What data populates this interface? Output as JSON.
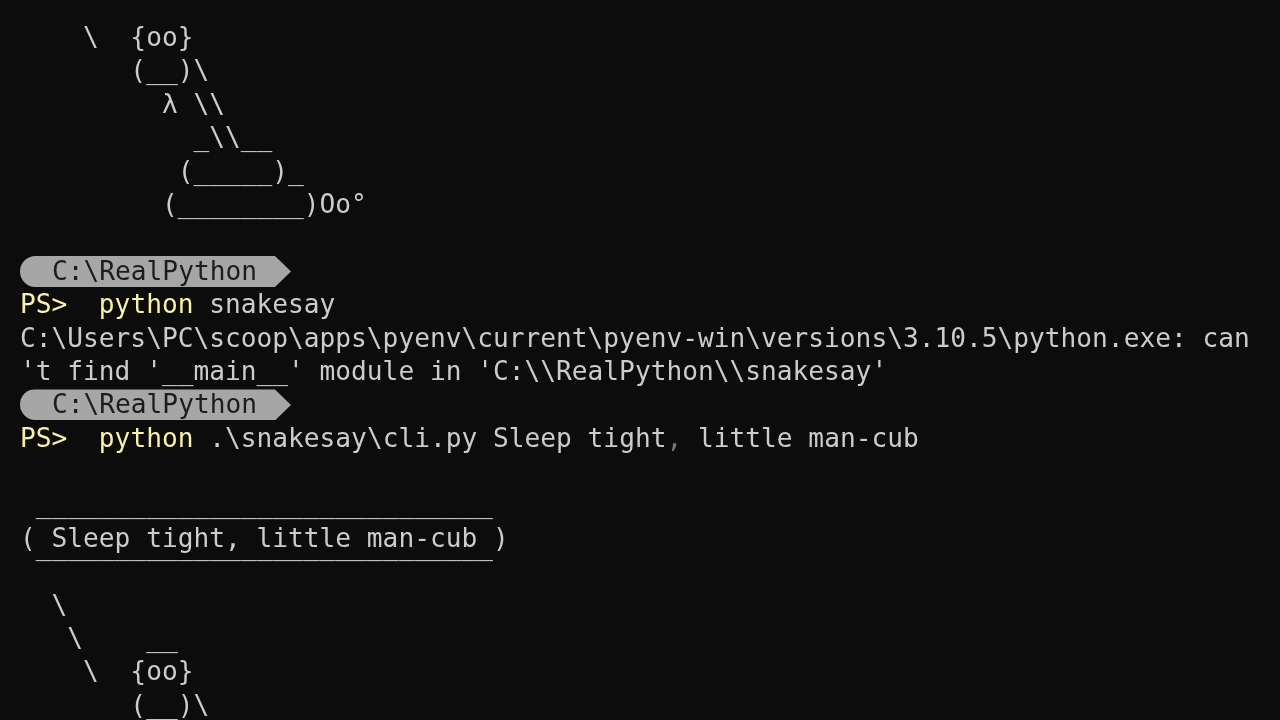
{
  "terminal": {
    "lines": [
      {
        "kind": "art",
        "text": "    \\  {oo}"
      },
      {
        "kind": "art",
        "text": "       (__)\\"
      },
      {
        "kind": "art",
        "text": "         λ \\\\"
      },
      {
        "kind": "art",
        "text": "           _\\\\__"
      },
      {
        "kind": "art",
        "text": "          (_____)_"
      },
      {
        "kind": "art",
        "text": "         (________)Oo°"
      },
      {
        "kind": "blank"
      },
      {
        "kind": "path",
        "text": "C:\\RealPython"
      },
      {
        "kind": "prompt",
        "prompt": "PS>",
        "tokens": [
          {
            "text": "python",
            "kind": "command"
          },
          {
            "text": " snakesay",
            "kind": "argument"
          }
        ]
      },
      {
        "kind": "output",
        "text": "C:\\Users\\PC\\scoop\\apps\\pyenv\\current\\pyenv-win\\versions\\3.10.5\\python.exe: can"
      },
      {
        "kind": "output",
        "text": "'t find '__main__' module in 'C:\\\\RealPython\\\\snakesay'"
      },
      {
        "kind": "path",
        "text": "C:\\RealPython"
      },
      {
        "kind": "prompt",
        "prompt": "PS>",
        "tokens": [
          {
            "text": "python",
            "kind": "command"
          },
          {
            "text": " .\\snakesay\\cli.py Sleep tight",
            "kind": "argument"
          },
          {
            "text": ",",
            "kind": "operator"
          },
          {
            "text": " little man-cub",
            "kind": "argument"
          }
        ]
      },
      {
        "kind": "blank"
      },
      {
        "kind": "bubble",
        "text": " _____________________________"
      },
      {
        "kind": "bubble",
        "text": "( Sleep tight, little man-cub )"
      },
      {
        "kind": "bubble",
        "text": " ‾‾‾‾‾‾‾‾‾‾‾‾‾‾‾‾‾‾‾‾‾‾‾‾‾‾‾‾‾"
      },
      {
        "kind": "art",
        "text": "  \\"
      },
      {
        "kind": "art",
        "text": "   \\    __"
      },
      {
        "kind": "art",
        "text": "    \\  {oo}"
      },
      {
        "kind": "art",
        "text": "       (__)\\"
      }
    ]
  }
}
